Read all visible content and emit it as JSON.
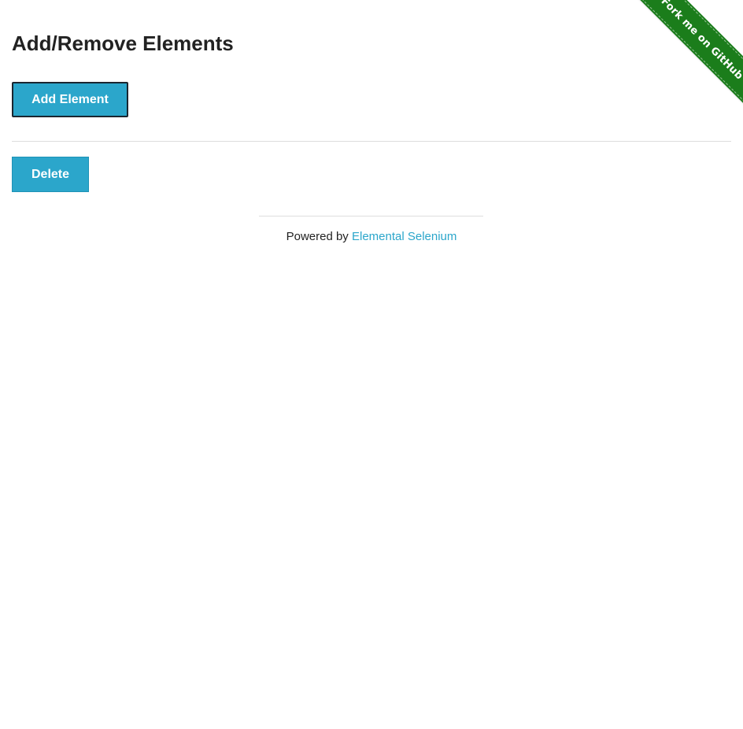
{
  "ribbon": {
    "label": "Fork me on GitHub",
    "color": "#1b7d1b"
  },
  "heading": {
    "title": "Add/Remove Elements"
  },
  "actions": {
    "add_label": "Add Element",
    "delete_label": "Delete",
    "button_color": "#2ba6cb"
  },
  "footer": {
    "prefix": "Powered by",
    "link_label": "Elemental Selenium",
    "link_color": "#2ba6cb"
  }
}
